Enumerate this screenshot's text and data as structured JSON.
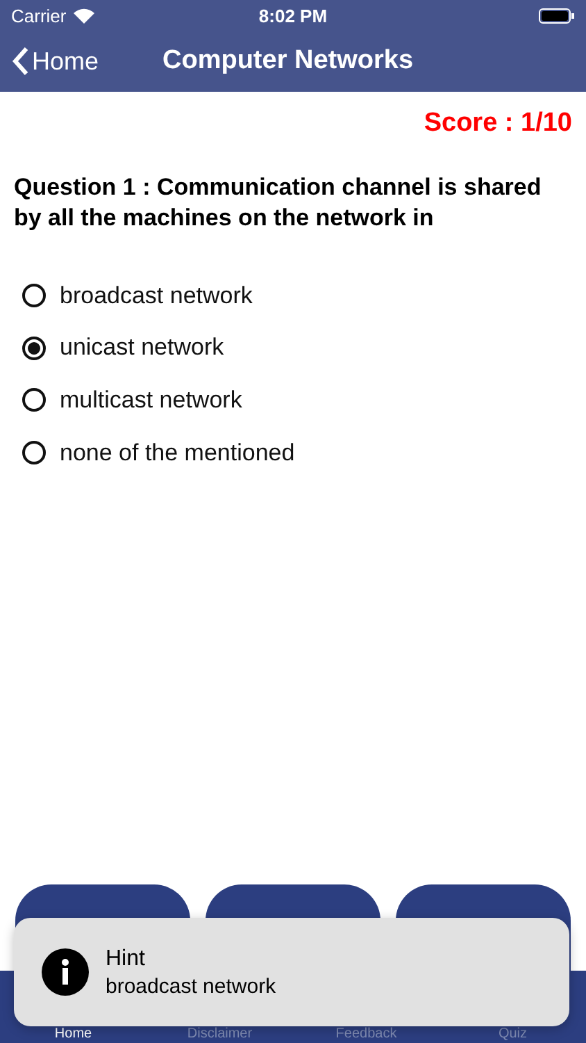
{
  "status_bar": {
    "carrier": "Carrier",
    "time": "8:02 PM"
  },
  "nav": {
    "back": "Home",
    "title": "Computer Networks"
  },
  "score": "Score : 1/10",
  "question": "Question 1 : Communication channel is shared by all the machines on the network in",
  "options": [
    {
      "label": "broadcast network",
      "selected": false
    },
    {
      "label": "unicast network",
      "selected": true
    },
    {
      "label": "multicast network",
      "selected": false
    },
    {
      "label": "none of the mentioned",
      "selected": false
    }
  ],
  "action_buttons": [
    {
      "kind": "button"
    },
    {
      "kind": "button"
    },
    {
      "kind": "button"
    }
  ],
  "tabs": [
    {
      "label": "Home",
      "selected": true
    },
    {
      "label": "Disclaimer",
      "selected": false
    },
    {
      "label": "Feedback",
      "selected": false
    },
    {
      "label": "Quiz",
      "selected": false
    }
  ],
  "toast": {
    "title": "Hint",
    "message": "broadcast network"
  }
}
